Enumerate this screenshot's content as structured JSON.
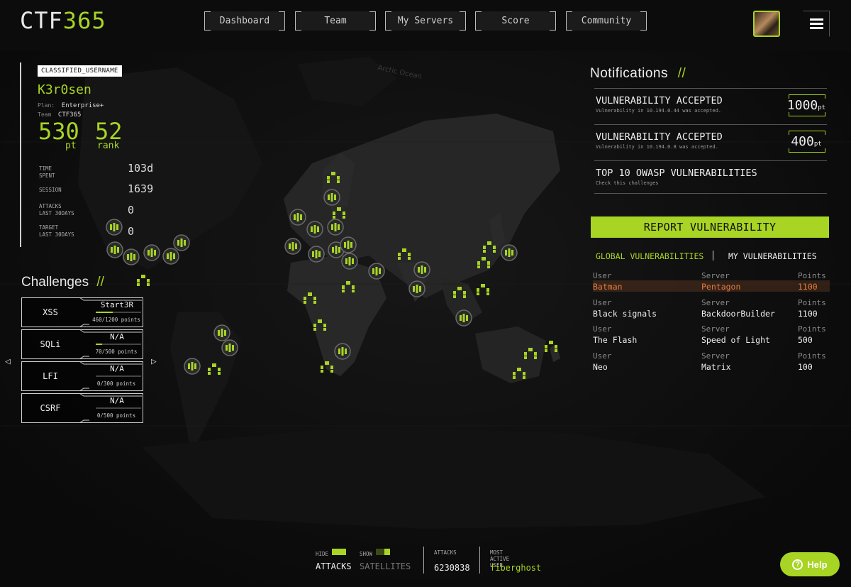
{
  "header": {
    "logo_prefix": "CTF",
    "logo_suffix": "365",
    "nav": [
      "Dashboard",
      "Team",
      "My Servers",
      "Score",
      "Community"
    ]
  },
  "user": {
    "classified_label": "CLASSIFIED_USERNAME",
    "username": "K3r0sen",
    "plan_label": "Plan:",
    "plan": "Enterprise+",
    "team_label": "Team",
    "team": "CTF365",
    "points": "530",
    "points_unit": "pt",
    "rank": "52",
    "rank_unit": "rank",
    "stats": [
      {
        "label": "TIME SPENT",
        "value": "103d"
      },
      {
        "label": "SESSION",
        "value": "1639"
      },
      {
        "label": "ATTACKS\nLAST 30DAYS",
        "value": "0"
      },
      {
        "label": "TARGET\nLAST 30DAYS",
        "value": "0"
      }
    ]
  },
  "challenges": {
    "title": "Challenges",
    "title_suffix": "//",
    "prev": "◁",
    "next": "▷",
    "items": [
      {
        "name": "XSS",
        "status": "Start3R",
        "points": "460/1200 points",
        "progress": 0.38
      },
      {
        "name": "SQLi",
        "status": "N/A",
        "points": "70/500 points",
        "progress": 0.14
      },
      {
        "name": "LFI",
        "status": "N/A",
        "points": "0/300 points",
        "progress": 0
      },
      {
        "name": "CSRF",
        "status": "N/A",
        "points": "0/500 points",
        "progress": 0
      }
    ]
  },
  "notifications": {
    "title": "Notifications",
    "title_suffix": "//",
    "items": [
      {
        "title": "VULNERABILITY ACCEPTED",
        "sub": "Vulnerability in 10.194.0.44 was accepted.",
        "points": "1000",
        "unit": "pt"
      },
      {
        "title": "VULNERABILITY ACCEPTED",
        "sub": "Vulnerability in 10.194.0.8 was accepted.",
        "points": "400",
        "unit": "pt"
      },
      {
        "title": "TOP 10 OWASP VULNERABILITIES",
        "sub": "Check this challenges",
        "points": "",
        "unit": ""
      }
    ]
  },
  "report_button": "REPORT VULNERABILITY",
  "vuln_tabs": {
    "global": "GLOBAL VULNERABILITIES",
    "mine": "MY VULNERABILITIES",
    "separator": "|"
  },
  "vulnerabilities": {
    "headers": {
      "user": "User",
      "server": "Server",
      "points": "Points"
    },
    "rows": [
      {
        "user": "Batman",
        "server": "Pentagon",
        "points": "1100"
      },
      {
        "user": "Black signals",
        "server": "BackdoorBuilder",
        "points": "1100"
      },
      {
        "user": "The Flash",
        "server": "Speed of Light",
        "points": "500"
      },
      {
        "user": "Neo",
        "server": "Matrix",
        "points": "100"
      }
    ]
  },
  "map": {
    "label": "Arctic Ocean"
  },
  "footer": {
    "hide_label": "HIDE",
    "attacks_toggle": "ATTACKS",
    "show_label": "SHOW",
    "satellites_toggle": "SATELLITES",
    "attacks_label": "ATTACKS",
    "attacks_value": "6230838",
    "most_active_label": "MOST ACTIVE USER",
    "most_active_value": "fiberghost"
  },
  "help": {
    "label": "Help",
    "icon": "?"
  },
  "colors": {
    "accent": "#a8d424",
    "highlight": "#e07a3c",
    "background": "#0b0b0b"
  }
}
